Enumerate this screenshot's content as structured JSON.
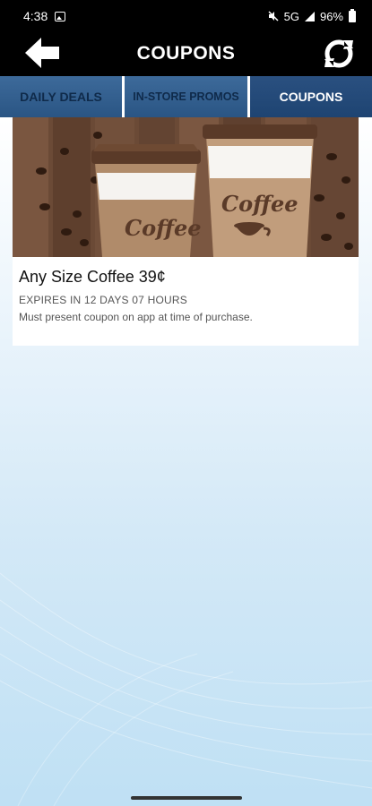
{
  "status_bar": {
    "time": "4:38",
    "network": "5G",
    "battery": "96%"
  },
  "header": {
    "title": "COUPONS",
    "back_icon": "back-arrow-icon",
    "refresh_icon": "refresh-icon"
  },
  "tabs": [
    {
      "label": "DAILY DEALS",
      "selected": false
    },
    {
      "label": "IN-STORE PROMOS",
      "selected": false
    },
    {
      "label": "COUPONS",
      "selected": true
    }
  ],
  "coupon": {
    "image_text": "Coffee",
    "title": "Any Size Coffee 39¢",
    "expiry": "EXPIRES IN 12 DAYS 07 HOURS",
    "note": "Must present coupon on app at time of purchase."
  },
  "colors": {
    "tab_blue": "#2a5584",
    "header_black": "#000000",
    "background_light_blue": "#cfe7f6"
  }
}
